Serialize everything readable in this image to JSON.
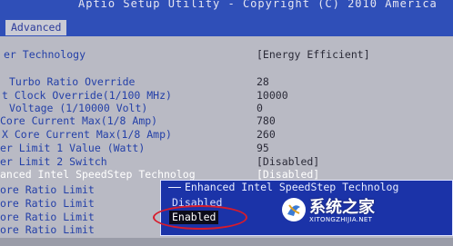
{
  "window": {
    "title": "Aptio Setup Utility - Copyright (C) 2010 America"
  },
  "tabs": [
    {
      "label": "Advanced"
    }
  ],
  "settings": [
    {
      "label": "er Technology",
      "value": "[Energy Efficient]"
    },
    {
      "label": "Turbo Ratio Override",
      "value": "28"
    },
    {
      "label": "t Clock Override(1/100 MHz)",
      "value": "10000"
    },
    {
      "label": "Voltage (1/10000 Volt)",
      "value": "0"
    },
    {
      "label": "Core Current Max(1/8 Amp)",
      "value": "780"
    },
    {
      "label": "X Core Current Max(1/8 Amp)",
      "value": "260"
    },
    {
      "label": "er Limit 1 Value (Watt)",
      "value": "95"
    },
    {
      "label": "er Limit 2 Switch",
      "value": "[Disabled]"
    },
    {
      "label": "anced Intel SpeedStep Technolog",
      "value": "[Disabled]"
    },
    {
      "label": "ore Ratio Limit",
      "value": ""
    },
    {
      "label": "ore Ratio Limit",
      "value": ""
    },
    {
      "label": "ore Ratio Limit",
      "value": ""
    },
    {
      "label": "ore Ratio Limit",
      "value": ""
    }
  ],
  "popup": {
    "title": "Enhanced Intel SpeedStep Technolog",
    "options": [
      "Disabled",
      "Enabled"
    ],
    "selected": "Enabled"
  },
  "watermark": {
    "brand": "系统之家",
    "url": "XITONGZHIJIA.NET"
  },
  "colors": {
    "title_bar": "#2f4fb8",
    "background": "#b9bac4",
    "label_text": "#2440a8",
    "popup_bg": "#1b33a8",
    "annotation_circle": "#d81b2b"
  }
}
